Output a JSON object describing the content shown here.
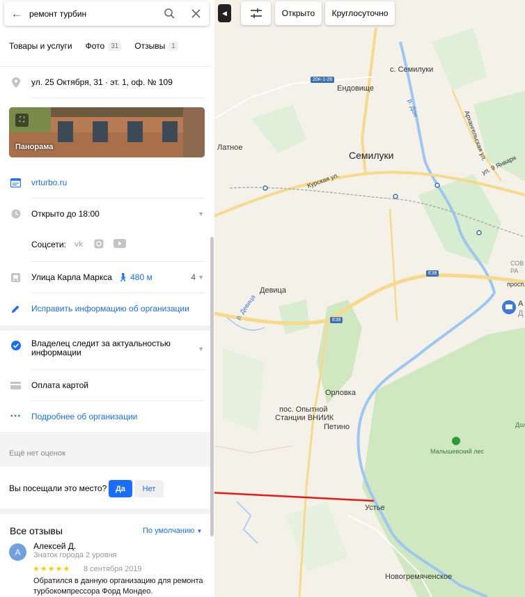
{
  "search": {
    "value": "ремонт турбин"
  },
  "tabs": [
    {
      "label": "Товары и услуги"
    },
    {
      "label": "Фото",
      "count": "31"
    },
    {
      "label": "Отзывы",
      "count": "1"
    }
  ],
  "address": "ул. 25 Октября, 31 · эт. 1, оф. № 109",
  "panorama_label": "Панорама",
  "website": "vrturbo.ru",
  "hours": "Открыто до 18:00",
  "social_label": "Соцсети:",
  "metro": {
    "name": "Улица Карла Маркса",
    "distance": "480 м",
    "count": "4"
  },
  "edit_link": "Исправить информацию об организации",
  "owner_note": "Владелец следит за актуальностью информации",
  "payment": "Оплата картой",
  "more_link": "Подробнее об организации",
  "no_ratings": "Ещё нет оценок",
  "visited": {
    "question": "Вы посещали это место?",
    "yes": "Да",
    "no": "Нет"
  },
  "reviews": {
    "title": "Все отзывы",
    "sort": "По умолчанию",
    "items": [
      {
        "initial": "А",
        "author": "Алексей Д.",
        "level": "Знаток города 2 уровня",
        "rating": 5,
        "stars": "★★★★★",
        "date": "8 сентября 2019",
        "text": "Обратился в данную организацию для ремонта турбокомпрессора Форд Мондео."
      }
    ]
  },
  "map_controls": {
    "open": "Открыто",
    "allday": "Круглосуточно"
  },
  "map": {
    "labels": {
      "semiluki_s": "с. Семилуки",
      "endovishche": "Ендовище",
      "semiluki": "Семилуки",
      "latnoe": "Латное",
      "kurskaya": "Курская ул.",
      "arkhangelskaya": "Архангельская ул.",
      "9yanvarya": "ул. 9 Января",
      "devitsa": "Девица",
      "river_devitsa": "р. Девица",
      "orlovka": "Орловка",
      "opytnoy": "пос. Опытной",
      "stantsii": "Станции ВНИИК",
      "petino": "Петино",
      "malyshevsky": "Малышевский лес",
      "ustye": "Устье",
      "novogremyachenskoe": "Новогремяченское",
      "river_don": "р. Дон",
      "prosp": "просп.",
      "sov": "СОВ",
      "ra": "РА",
      "a_poi": "А",
      "d_poi": "Д",
      "dol": "Дол"
    },
    "badges": {
      "r20k": "20К-1-28",
      "e38a": "Е38",
      "e38b": "Е38"
    },
    "colors": {
      "background": "#f4f1e8",
      "forest": "#cfe8c2",
      "road": "#f7d98c",
      "water": "#9cc7f0",
      "accent": "#196dff",
      "arrow": "#e31b1b"
    }
  }
}
